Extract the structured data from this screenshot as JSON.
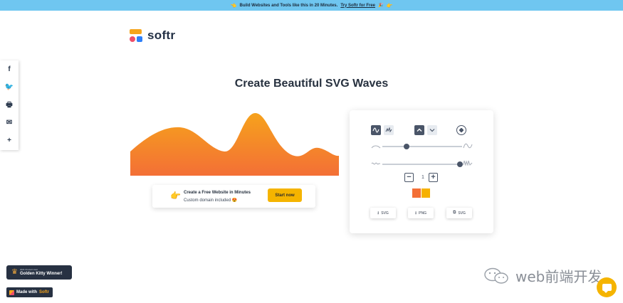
{
  "banner": {
    "left_emoji": "👈",
    "text": "Build Websites and Tools like this in 20 Minutes.",
    "link": "Try Softr for Free",
    "link_emoji": "🎉",
    "right_emoji": "👉"
  },
  "logo": {
    "text": "softr"
  },
  "share": {
    "facebook": "f",
    "twitter": "🐦",
    "print": "🖶",
    "email": "✉",
    "more": "+"
  },
  "page": {
    "title": "Create Beautiful SVG Waves"
  },
  "wave": {
    "gradient_start": "#f6a21c",
    "gradient_end": "#f36f36"
  },
  "cta": {
    "hand": "👉",
    "title": "Create a Free Website in Minutes",
    "subtitle": "Custom domain included 😍",
    "button": "Start now"
  },
  "controls": {
    "wave_type_icons": [
      "smooth-wave-icon",
      "peaked-wave-icon"
    ],
    "direction_icons": [
      "arrow-up-icon",
      "arrow-down-icon"
    ],
    "randomize_icon": "dice-icon",
    "amplitude_level": 0.3,
    "complexity_level": 0.97,
    "layers_value": "1",
    "minus": "−",
    "plus": "+",
    "colors": [
      "#f36f36",
      "#f6b100"
    ]
  },
  "downloads": [
    {
      "label": "SVG",
      "icon": "⭳"
    },
    {
      "label": "PNG",
      "icon": "⭳"
    },
    {
      "label": "SVG",
      "icon": "⧉"
    }
  ],
  "badges": {
    "ph_small": "2021 Product Hunt",
    "ph_big": "Golden Kitty Winner!",
    "made_prefix": "Made with",
    "made_brand": "Softr"
  },
  "watermark": {
    "text": "web前端开发"
  }
}
